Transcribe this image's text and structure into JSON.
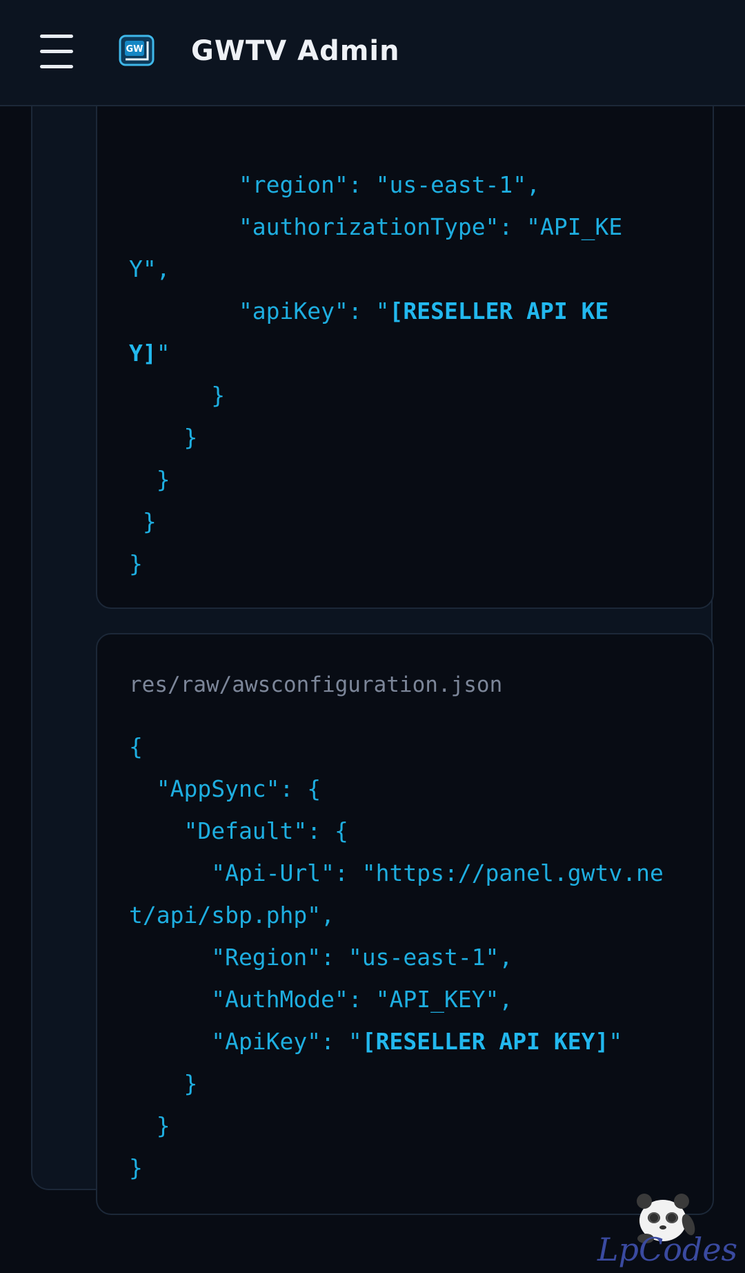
{
  "header": {
    "title": "GWTV Admin",
    "logo_text": "GW",
    "menu_icon": "hamburger-menu-icon"
  },
  "cards": [
    {
      "filename": "",
      "lines": [
        [
          "        \"region\": \"us-east-1\","
        ],
        [
          "        \"authorizationType\": \"API_KE"
        ],
        [
          "Y\","
        ],
        [
          "        \"apiKey\": \"",
          {
            "bold": "[RESELLER API KE"
          }
        ],
        [
          {
            "bold": "Y]"
          },
          "\""
        ],
        [
          "      }"
        ],
        [
          "    }"
        ],
        [
          "  }"
        ],
        [
          " }"
        ],
        [
          "}"
        ]
      ]
    },
    {
      "filename": "res/raw/awsconfiguration.json",
      "lines": [
        [
          "{"
        ],
        [
          "  \"AppSync\": {"
        ],
        [
          "    \"Default\": {"
        ],
        [
          "      \"Api-Url\": \"https://panel.gwtv.ne"
        ],
        [
          "t/api/sbp.php\","
        ],
        [
          "      \"Region\": \"us-east-1\","
        ],
        [
          "      \"AuthMode\": \"API_KEY\","
        ],
        [
          "      \"ApiKey\": \"",
          {
            "bold": "[RESELLER API KEY]"
          },
          "\""
        ],
        [
          "    }"
        ],
        [
          "  }"
        ],
        [
          "}"
        ]
      ]
    }
  ],
  "watermark": {
    "text": "LpCodes",
    "icon": "panda-mascot-icon"
  },
  "colors": {
    "background": "#080c14",
    "surface": "#0c1420",
    "border": "#1c2838",
    "code": "#1eaee0",
    "muted": "#7c8699",
    "title": "#eef1f6"
  }
}
